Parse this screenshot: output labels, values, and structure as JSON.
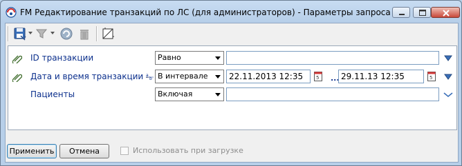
{
  "window": {
    "title": "FM Редактирование транзакций по ЛС (для администраторов) - Параметры запроса"
  },
  "toolbar": {
    "buttons": [
      "save-icon",
      "filter-icon",
      "refresh-icon",
      "trash-icon",
      "edit-icon"
    ]
  },
  "filters": [
    {
      "label": "ID транзакции",
      "operator": "Равно",
      "value": ""
    },
    {
      "label": "Дата и время транзакции",
      "operator": "В интервале",
      "from": "22.11.2013 12:35",
      "range_separator": "...",
      "to": "29.11.13 12:35"
    },
    {
      "label": "Пациенты",
      "operator": "Включая",
      "value": ""
    }
  ],
  "footer": {
    "apply_label": "Применить",
    "cancel_label": "Отмена",
    "use_on_load_label": "Использовать при загрузке",
    "use_on_load_checked": false
  },
  "colors": {
    "label_blue": "#0b2f8c",
    "arrow_blue": "#3a6fb8"
  }
}
